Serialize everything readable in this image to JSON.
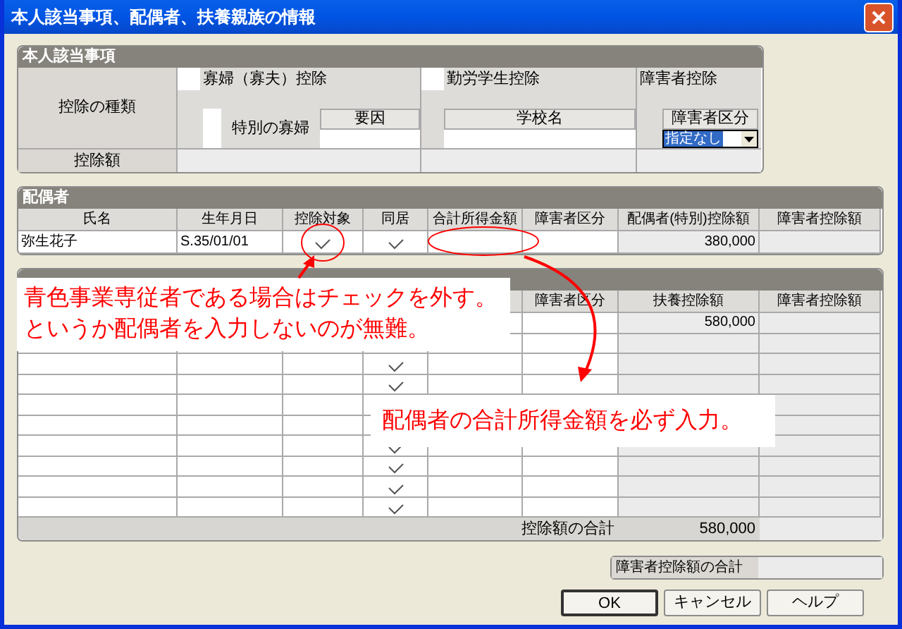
{
  "window": {
    "title": "本人該当事項、配偶者、扶養親族の情報"
  },
  "personal": {
    "title": "本人該当事項",
    "type_label": "控除の種類",
    "amount_label": "控除額",
    "widow": {
      "label": "寡婦（寡夫）控除",
      "checked": false,
      "special": {
        "label": "特別の寡婦",
        "checked": false
      },
      "reason_label": "要因"
    },
    "student": {
      "label": "勤労学生控除",
      "checked": false,
      "school_label": "学校名"
    },
    "disability": {
      "label": "障害者控除",
      "category_label": "障害者区分",
      "category_value": "指定なし"
    }
  },
  "spouse": {
    "title": "配偶者",
    "columns": [
      "氏名",
      "生年月日",
      "控除対象",
      "同居",
      "合計所得金額",
      "障害者区分",
      "配偶者(特別)控除額",
      "障害者控除額"
    ],
    "row": {
      "name": "弥生花子",
      "birth": "S.35/01/01",
      "deduction_target": true,
      "living_together": true,
      "deduction": "380,000"
    }
  },
  "dependents": {
    "columns": [
      "障害者区分",
      "扶養控除額",
      "障害者控除額"
    ],
    "rows": [
      {
        "deduction": "580,000"
      },
      {},
      {
        "living_together": true
      },
      {
        "living_together": true
      },
      {},
      {},
      {
        "living_together": true
      },
      {
        "living_together": true
      },
      {
        "living_together": true
      },
      {
        "living_together": true
      }
    ],
    "total_label": "控除額の合計",
    "total": "580,000"
  },
  "disability_total": {
    "label": "障害者控除額の合計"
  },
  "buttons": [
    {
      "label": "OK",
      "default": true
    },
    {
      "label": "キャンセル",
      "default": false
    },
    {
      "label": "ヘルプ",
      "default": false
    }
  ],
  "annotations": [
    {
      "lines": [
        "青色事業専従者である場合はチェックを外す。",
        "というか配偶者を入力しないのが無難。"
      ]
    },
    {
      "lines": [
        "配偶者の合計所得金額を必ず入力。"
      ]
    }
  ]
}
